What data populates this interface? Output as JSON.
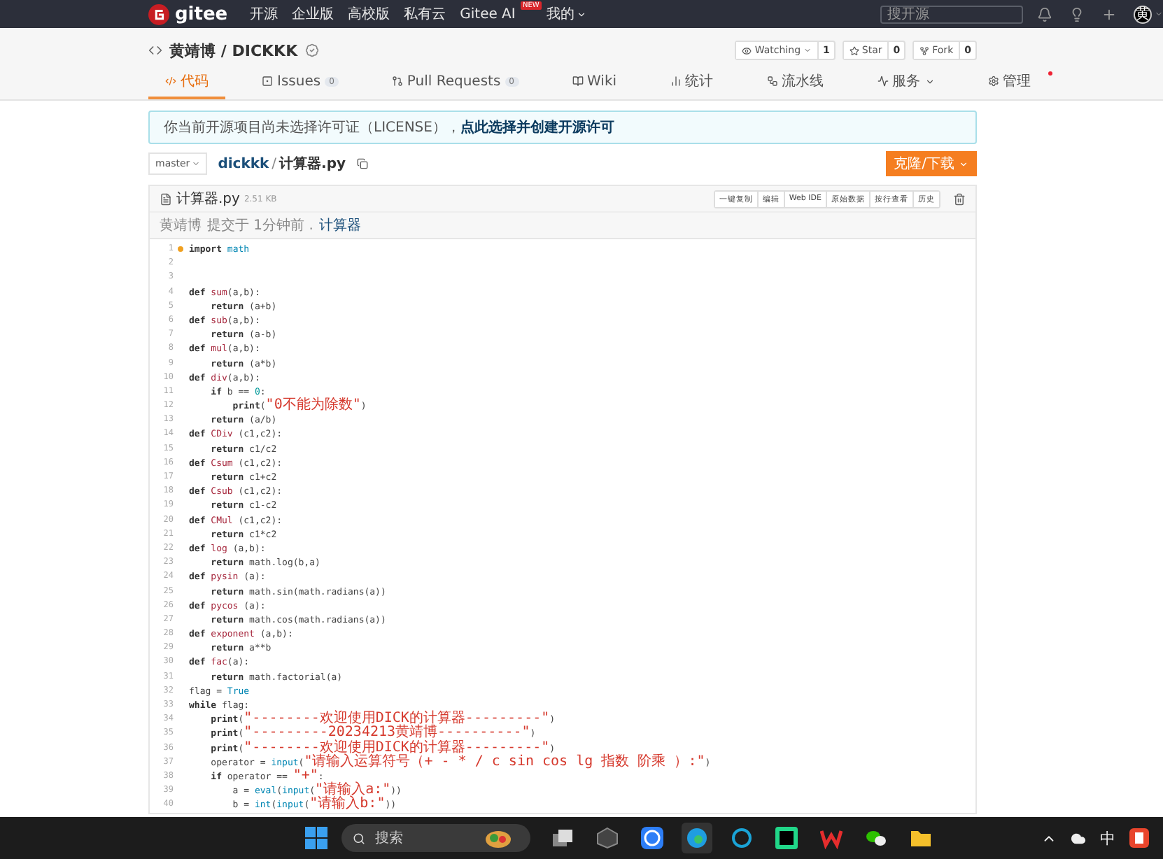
{
  "nav": {
    "logo": "gitee",
    "items": [
      {
        "label": "开源",
        "dropdown": false
      },
      {
        "label": "企业版",
        "dropdown": false
      },
      {
        "label": "高校版",
        "dropdown": false
      },
      {
        "label": "私有云",
        "dropdown": false
      },
      {
        "label": "Gitee AI",
        "badge": "NEW",
        "dropdown": false
      },
      {
        "label": "我的",
        "dropdown": true
      }
    ],
    "search": {
      "placeholder": "搜开源"
    },
    "avatar": "黄"
  },
  "repo": {
    "owner": "黄靖博",
    "separator": "/",
    "name": "DICKKK",
    "actions": [
      {
        "label": "Watching",
        "kind": "watch",
        "count": "1"
      },
      {
        "label": "Star",
        "kind": "star",
        "count": "0"
      },
      {
        "label": "Fork",
        "kind": "fork",
        "count": "0"
      }
    ]
  },
  "tabs": [
    {
      "label": "代码",
      "kind": "code",
      "selected": true
    },
    {
      "label": "Issues",
      "kind": "issues",
      "count": "0",
      "selected": false
    },
    {
      "label": "Pull Requests",
      "kind": "pr",
      "count": "0",
      "selected": false
    },
    {
      "label": "Wiki",
      "kind": "wiki",
      "selected": false
    },
    {
      "label": "统计",
      "kind": "stats",
      "selected": false
    },
    {
      "label": "流水线",
      "kind": "pipeline",
      "selected": false
    },
    {
      "label": "服务",
      "kind": "service",
      "selected": false
    },
    {
      "label": "管理",
      "kind": "manage",
      "selected": false
    }
  ],
  "notice": {
    "text": "你当前开源项目尚未选择许可证（LICENSE），",
    "link": "点此选择并创建开源许可"
  },
  "path": {
    "branch": "master",
    "repo": "dickkk",
    "separator": "/",
    "file": "计算器.py",
    "clone": "克隆/下载"
  },
  "file": {
    "name": "计算器.py",
    "size": "2.51 KB",
    "buttons": [
      "一键复制",
      "编辑",
      "Web IDE",
      "原始数据",
      "按行查看",
      "历史"
    ],
    "commit": {
      "author": "黄靖博",
      "text": "提交于 1分钟前 .",
      "message": "计算器"
    }
  },
  "code": [
    {
      "n": "1",
      "marked": true,
      "tokens": [
        {
          "kind": "keyword",
          "text": "import "
        },
        {
          "kind": "builtin",
          "text": "math"
        }
      ]
    },
    {
      "n": "2",
      "marked": false
    },
    {
      "n": "3",
      "marked": false
    },
    {
      "n": "4",
      "marked": false,
      "tokens": [
        {
          "kind": "keyword",
          "text": "def "
        },
        {
          "kind": "function",
          "text": "sum"
        },
        {
          "kind": "plain",
          "text": "(a,b):"
        }
      ]
    },
    {
      "n": "5",
      "marked": false,
      "tokens": [
        {
          "kind": "keyword",
          "text": "    return"
        },
        {
          "kind": "plain",
          "text": " (a+b)"
        }
      ]
    },
    {
      "n": "6",
      "marked": false,
      "tokens": [
        {
          "kind": "keyword",
          "text": "def "
        },
        {
          "kind": "function",
          "text": "sub"
        },
        {
          "kind": "plain",
          "text": "(a,b):"
        }
      ]
    },
    {
      "n": "7",
      "marked": false,
      "tokens": [
        {
          "kind": "keyword",
          "text": "    return"
        },
        {
          "kind": "plain",
          "text": " (a-b)"
        }
      ]
    },
    {
      "n": "8",
      "marked": false,
      "tokens": [
        {
          "kind": "keyword",
          "text": "def "
        },
        {
          "kind": "function",
          "text": "mul"
        },
        {
          "kind": "plain",
          "text": "(a,b):"
        }
      ]
    },
    {
      "n": "9",
      "marked": false,
      "tokens": [
        {
          "kind": "keyword",
          "text": "    return"
        },
        {
          "kind": "plain",
          "text": " (a*b)"
        }
      ]
    },
    {
      "n": "10",
      "marked": false,
      "tokens": [
        {
          "kind": "keyword",
          "text": "def "
        },
        {
          "kind": "function",
          "text": "div"
        },
        {
          "kind": "plain",
          "text": "(a,b):"
        }
      ]
    },
    {
      "n": "11",
      "marked": false,
      "tokens": [
        {
          "kind": "keyword",
          "text": "    if"
        },
        {
          "kind": "plain",
          "text": " b == "
        },
        {
          "kind": "number",
          "text": "0"
        },
        {
          "kind": "plain",
          "text": ":"
        }
      ]
    },
    {
      "n": "12",
      "marked": false,
      "tokens": [
        {
          "kind": "keyword",
          "text": "        print"
        },
        {
          "kind": "plain",
          "text": "("
        },
        {
          "kind": "string",
          "text": "\"0不能为除数\""
        },
        {
          "kind": "plain",
          "text": ")"
        }
      ]
    },
    {
      "n": "13",
      "marked": false,
      "tokens": [
        {
          "kind": "keyword",
          "text": "    return"
        },
        {
          "kind": "plain",
          "text": " (a/b)"
        }
      ]
    },
    {
      "n": "14",
      "marked": false,
      "tokens": [
        {
          "kind": "keyword",
          "text": "def "
        },
        {
          "kind": "function",
          "text": "CDiv"
        },
        {
          "kind": "plain",
          "text": " (c1,c2):"
        }
      ]
    },
    {
      "n": "15",
      "marked": false,
      "tokens": [
        {
          "kind": "keyword",
          "text": "    return"
        },
        {
          "kind": "plain",
          "text": " c1/c2"
        }
      ]
    },
    {
      "n": "16",
      "marked": false,
      "tokens": [
        {
          "kind": "keyword",
          "text": "def "
        },
        {
          "kind": "function",
          "text": "Csum"
        },
        {
          "kind": "plain",
          "text": " (c1,c2):"
        }
      ]
    },
    {
      "n": "17",
      "marked": false,
      "tokens": [
        {
          "kind": "keyword",
          "text": "    return"
        },
        {
          "kind": "plain",
          "text": " c1+c2"
        }
      ]
    },
    {
      "n": "18",
      "marked": false,
      "tokens": [
        {
          "kind": "keyword",
          "text": "def "
        },
        {
          "kind": "function",
          "text": "Csub"
        },
        {
          "kind": "plain",
          "text": " (c1,c2):"
        }
      ]
    },
    {
      "n": "19",
      "marked": false,
      "tokens": [
        {
          "kind": "keyword",
          "text": "    return"
        },
        {
          "kind": "plain",
          "text": " c1-c2"
        }
      ]
    },
    {
      "n": "20",
      "marked": false,
      "tokens": [
        {
          "kind": "keyword",
          "text": "def "
        },
        {
          "kind": "function",
          "text": "CMul"
        },
        {
          "kind": "plain",
          "text": " (c1,c2):"
        }
      ]
    },
    {
      "n": "21",
      "marked": false,
      "tokens": [
        {
          "kind": "keyword",
          "text": "    return"
        },
        {
          "kind": "plain",
          "text": " c1*c2"
        }
      ]
    },
    {
      "n": "22",
      "marked": false,
      "tokens": [
        {
          "kind": "keyword",
          "text": "def "
        },
        {
          "kind": "function",
          "text": "log"
        },
        {
          "kind": "plain",
          "text": " (a,b):"
        }
      ]
    },
    {
      "n": "23",
      "marked": false,
      "tokens": [
        {
          "kind": "keyword",
          "text": "    return"
        },
        {
          "kind": "plain",
          "text": " math.log(b,a)"
        }
      ]
    },
    {
      "n": "24",
      "marked": false,
      "tokens": [
        {
          "kind": "keyword",
          "text": "def "
        },
        {
          "kind": "function",
          "text": "pysin"
        },
        {
          "kind": "plain",
          "text": " (a):"
        }
      ]
    },
    {
      "n": "25",
      "marked": false,
      "tokens": [
        {
          "kind": "keyword",
          "text": "    return"
        },
        {
          "kind": "plain",
          "text": " math.sin(math.radians(a))"
        }
      ]
    },
    {
      "n": "26",
      "marked": false,
      "tokens": [
        {
          "kind": "keyword",
          "text": "def "
        },
        {
          "kind": "function",
          "text": "pycos"
        },
        {
          "kind": "plain",
          "text": " (a):"
        }
      ]
    },
    {
      "n": "27",
      "marked": false,
      "tokens": [
        {
          "kind": "keyword",
          "text": "    return"
        },
        {
          "kind": "plain",
          "text": " math.cos(math.radians(a))"
        }
      ]
    },
    {
      "n": "28",
      "marked": false,
      "tokens": [
        {
          "kind": "keyword",
          "text": "def "
        },
        {
          "kind": "function",
          "text": "exponent"
        },
        {
          "kind": "plain",
          "text": " (a,b):"
        }
      ]
    },
    {
      "n": "29",
      "marked": false,
      "tokens": [
        {
          "kind": "keyword",
          "text": "    return"
        },
        {
          "kind": "plain",
          "text": " a**b"
        }
      ]
    },
    {
      "n": "30",
      "marked": false,
      "tokens": [
        {
          "kind": "keyword",
          "text": "def "
        },
        {
          "kind": "function",
          "text": "fac"
        },
        {
          "kind": "plain",
          "text": "(a):"
        }
      ]
    },
    {
      "n": "31",
      "marked": false,
      "tokens": [
        {
          "kind": "keyword",
          "text": "    return"
        },
        {
          "kind": "plain",
          "text": " math.factorial(a)"
        }
      ]
    },
    {
      "n": "32",
      "marked": false,
      "tokens": [
        {
          "kind": "plain",
          "text": "flag = "
        },
        {
          "kind": "builtin",
          "text": "True"
        }
      ]
    },
    {
      "n": "33",
      "marked": false,
      "tokens": [
        {
          "kind": "keyword",
          "text": "while"
        },
        {
          "kind": "plain",
          "text": " flag:"
        }
      ]
    },
    {
      "n": "34",
      "marked": false,
      "tokens": [
        {
          "kind": "keyword",
          "text": "    print"
        },
        {
          "kind": "plain",
          "text": "("
        },
        {
          "kind": "string",
          "text": "\"--------欢迎使用DICK的计算器---------\""
        },
        {
          "kind": "plain",
          "text": ")"
        }
      ]
    },
    {
      "n": "35",
      "marked": false,
      "tokens": [
        {
          "kind": "keyword",
          "text": "    print"
        },
        {
          "kind": "plain",
          "text": "("
        },
        {
          "kind": "string",
          "text": "\"---------20234213黄靖博----------\""
        },
        {
          "kind": "plain",
          "text": ")"
        }
      ]
    },
    {
      "n": "36",
      "marked": false,
      "tokens": [
        {
          "kind": "keyword",
          "text": "    print"
        },
        {
          "kind": "plain",
          "text": "("
        },
        {
          "kind": "string",
          "text": "\"--------欢迎使用DICK的计算器---------\""
        },
        {
          "kind": "plain",
          "text": ")"
        }
      ]
    },
    {
      "n": "37",
      "marked": false,
      "tokens": [
        {
          "kind": "plain",
          "text": "    operator = "
        },
        {
          "kind": "builtin",
          "text": "input"
        },
        {
          "kind": "plain",
          "text": "("
        },
        {
          "kind": "string",
          "text": "\"请输入运算符号（+ - * / c sin cos lg 指数 阶乘 ）:\""
        },
        {
          "kind": "plain",
          "text": ")"
        }
      ]
    },
    {
      "n": "38",
      "marked": false,
      "tokens": [
        {
          "kind": "keyword",
          "text": "    if"
        },
        {
          "kind": "plain",
          "text": " operator == "
        },
        {
          "kind": "string",
          "text": "\"+\""
        },
        {
          "kind": "plain",
          "text": ":"
        }
      ]
    },
    {
      "n": "39",
      "marked": false,
      "tokens": [
        {
          "kind": "plain",
          "text": "        a = "
        },
        {
          "kind": "builtin",
          "text": "eval"
        },
        {
          "kind": "plain",
          "text": "("
        },
        {
          "kind": "builtin",
          "text": "input"
        },
        {
          "kind": "plain",
          "text": "("
        },
        {
          "kind": "string",
          "text": "\"请输入a:\""
        },
        {
          "kind": "plain",
          "text": "))"
        }
      ]
    },
    {
      "n": "40",
      "marked": false,
      "tokens": [
        {
          "kind": "plain",
          "text": "        b = "
        },
        {
          "kind": "builtin",
          "text": "int"
        },
        {
          "kind": "plain",
          "text": "("
        },
        {
          "kind": "builtin",
          "text": "input"
        },
        {
          "kind": "plain",
          "text": "("
        },
        {
          "kind": "string",
          "text": "\"请输入b:\""
        },
        {
          "kind": "plain",
          "text": "))"
        }
      ]
    }
  ],
  "taskbar": {
    "search": {
      "placeholder": "搜索"
    },
    "apps": [
      {
        "kind": "taskview",
        "selected": false
      },
      {
        "kind": "cube",
        "selected": false
      },
      {
        "kind": "k",
        "selected": false
      },
      {
        "kind": "edge",
        "selected": true
      },
      {
        "kind": "ring",
        "selected": false
      },
      {
        "kind": "pycharm",
        "selected": false
      },
      {
        "kind": "wps",
        "selected": false
      },
      {
        "kind": "wechat",
        "selected": false
      },
      {
        "kind": "folder",
        "selected": false
      }
    ],
    "ime": "中"
  }
}
